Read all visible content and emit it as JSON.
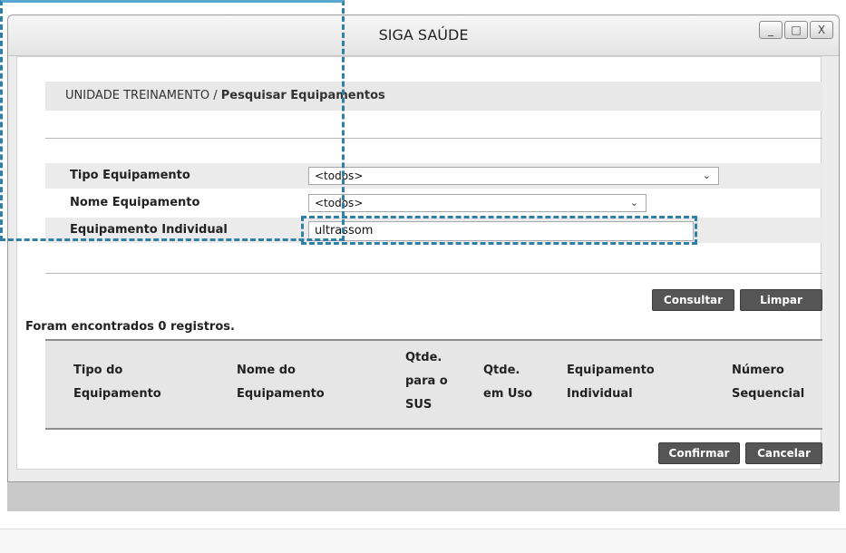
{
  "window": {
    "title": "SIGA SAÚDE",
    "controls": {
      "minimize": "_",
      "maximize": "□",
      "close": "X"
    }
  },
  "breadcrumb": {
    "unit": "UNIDADE TREINAMENTO /",
    "page": "Pesquisar Equipamentos"
  },
  "filters": {
    "tipo_label": "Tipo Equipamento",
    "tipo_value": "<todos>",
    "nome_label": "Nome Equipamento",
    "nome_value": "<todos>",
    "individual_label": "Equipamento Individual",
    "individual_value": "ultrassom"
  },
  "actions": {
    "consultar": "Consultar",
    "limpar": "Limpar",
    "confirmar": "Confirmar",
    "cancelar": "Cancelar"
  },
  "results": {
    "count_text": "Foram encontrados 0 registros.",
    "columns": [
      {
        "line1": "Tipo do",
        "line2": "Equipamento",
        "line3": ""
      },
      {
        "line1": "Nome do",
        "line2": "Equipamento",
        "line3": ""
      },
      {
        "line1": "Qtde.",
        "line2": "para o",
        "line3": "SUS"
      },
      {
        "line1": "Qtde.",
        "line2": "em Uso",
        "line3": ""
      },
      {
        "line1": "Equipamento",
        "line2": "Individual",
        "line3": ""
      },
      {
        "line1": "Número",
        "line2": "Sequencial",
        "line3": ""
      }
    ]
  },
  "colors": {
    "button_bg": "#555555",
    "highlight": "#2f7fa6"
  },
  "icons": {
    "dropdown": "chevron-down-icon"
  }
}
